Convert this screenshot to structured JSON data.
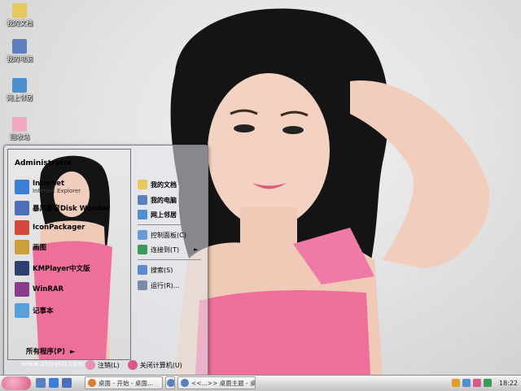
{
  "desktop": {
    "icons": [
      {
        "label": "我的文档",
        "icon": "my-documents-icon",
        "color": "#e8c85a"
      },
      {
        "label": "我的电脑",
        "icon": "my-computer-icon",
        "color": "#5b7fbf"
      },
      {
        "label": "网上邻居",
        "icon": "network-icon",
        "color": "#4d8fcf"
      },
      {
        "label": "回收站",
        "icon": "recycle-bin-icon",
        "color": "#f4a8c4"
      }
    ]
  },
  "start_menu": {
    "user": "Administrator",
    "programs": [
      {
        "label": "Internet",
        "sub": "Internet Explorer",
        "icon": "internet-explorer-icon",
        "color": "#3a7fd5"
      },
      {
        "label": "暴风影音Disk Wonder",
        "sub": "",
        "icon": "media-player-icon",
        "color": "#4c6fb8"
      },
      {
        "label": "IconPackager",
        "sub": "",
        "icon": "iconpackager-icon",
        "color": "#d14a3a"
      },
      {
        "label": "画图",
        "sub": "",
        "icon": "paint-icon",
        "color": "#c9a03a"
      },
      {
        "label": "KMPlayer中文版",
        "sub": "",
        "icon": "kmplayer-icon",
        "color": "#2d3f6e"
      },
      {
        "label": "WinRAR",
        "sub": "",
        "icon": "winrar-icon",
        "color": "#8a3c8f"
      },
      {
        "label": "记事本",
        "sub": "",
        "icon": "notepad-icon",
        "color": "#5aa0d8"
      }
    ],
    "all_programs": "所有程序(P)",
    "site": "www.zhuoku.com",
    "places": [
      {
        "label": "我的文档",
        "icon": "my-documents-icon",
        "color": "#e8c85a",
        "bold": true
      },
      {
        "label": "我的电脑",
        "icon": "my-computer-icon",
        "color": "#5b7fbf",
        "bold": true
      },
      {
        "label": "网上邻居",
        "icon": "network-icon",
        "color": "#4d8fcf",
        "bold": true
      },
      {
        "label": "控制面板(C)",
        "icon": "control-panel-icon",
        "color": "#6b9bd6",
        "bold": false
      },
      {
        "label": "连接到(T)",
        "icon": "connect-icon",
        "color": "#3c9a5a",
        "bold": false
      },
      {
        "label": "搜索(S)",
        "icon": "search-icon",
        "color": "#5a8ad0",
        "bold": false
      },
      {
        "label": "运行(R)...",
        "icon": "run-icon",
        "color": "#7c8ca8",
        "bold": false
      }
    ],
    "logoff": "注销(L)",
    "shutdown": "关闭计算机(U)"
  },
  "taskbar": {
    "tasks": [
      {
        "label": "桌面 - 开始 - 桌面...",
        "icon": "browser-icon",
        "color": "#e0792a"
      },
      {
        "label": "<<...>>",
        "icon": "window-icon",
        "color": "#5a7fbf"
      },
      {
        "label": "<<...>> 桌面主题 - 桌...",
        "icon": "window-icon",
        "color": "#5a7fbf"
      }
    ],
    "clock": "18:22"
  }
}
